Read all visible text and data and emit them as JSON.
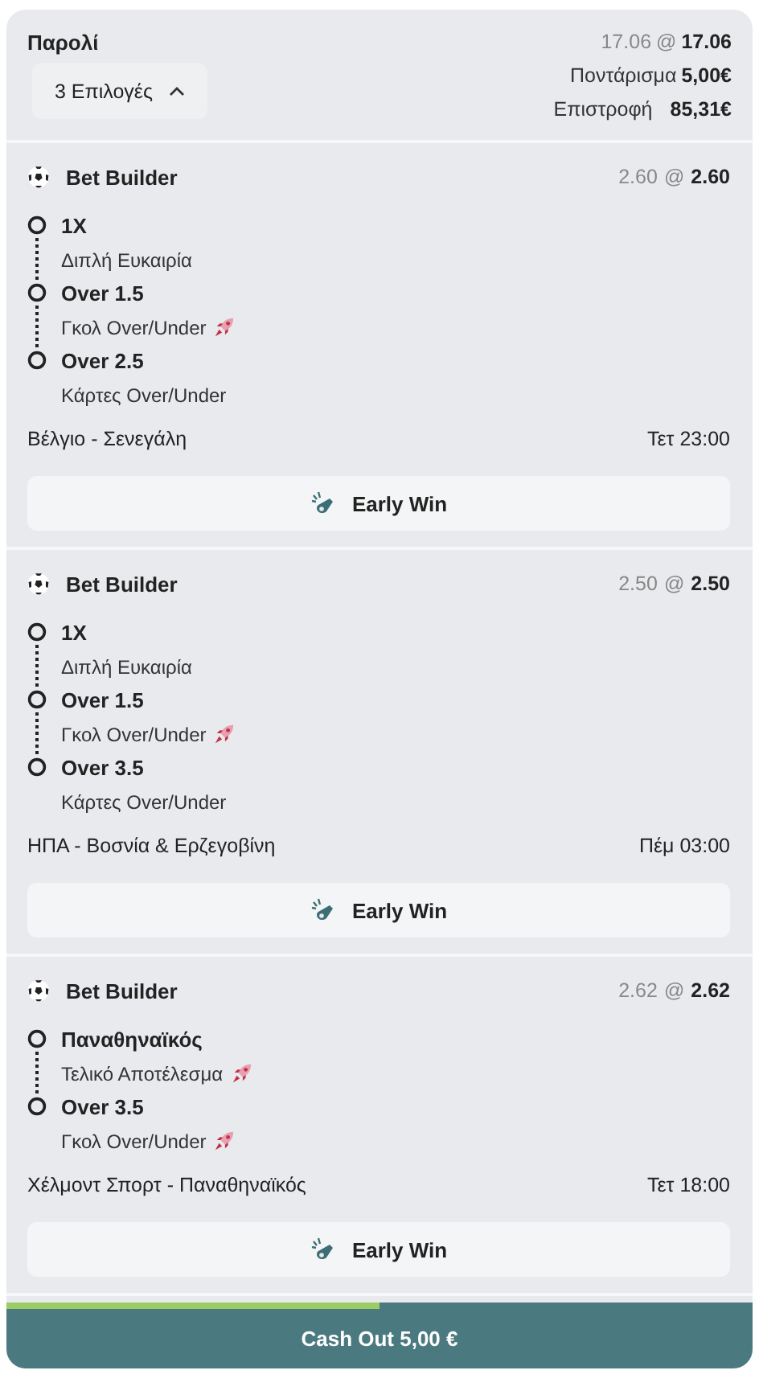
{
  "header": {
    "title": "Παρολί",
    "selections_button": {
      "label": "3 Επιλογές",
      "expanded": true
    },
    "original_odds": "17.06",
    "at": "@",
    "odds": "17.06",
    "stake_label": "Ποντάρισμα",
    "stake": "5,00€",
    "return_label": "Επιστροφή",
    "return": "85,31€"
  },
  "bets": [
    {
      "title": "Bet Builder",
      "original_odds": "2.60",
      "at": "@",
      "odds": "2.60",
      "selections": [
        {
          "pick": "1X",
          "market": "Διπλή Ευκαιρία",
          "boosted": false
        },
        {
          "pick": "Over 1.5",
          "market": "Γκολ Over/Under",
          "boosted": true
        },
        {
          "pick": "Over 2.5",
          "market": "Κάρτες Over/Under",
          "boosted": false
        }
      ],
      "match": "Βέλγιο - Σενεγάλη",
      "time": "Τετ 23:00",
      "button": "Early Win"
    },
    {
      "title": "Bet Builder",
      "original_odds": "2.50",
      "at": "@",
      "odds": "2.50",
      "selections": [
        {
          "pick": "1X",
          "market": "Διπλή Ευκαιρία",
          "boosted": false
        },
        {
          "pick": "Over 1.5",
          "market": "Γκολ Over/Under",
          "boosted": true
        },
        {
          "pick": "Over 3.5",
          "market": "Κάρτες Over/Under",
          "boosted": false
        }
      ],
      "match": "ΗΠΑ - Βοσνία & Ερζεγοβίνη",
      "time": "Πέμ 03:00",
      "button": "Early Win"
    },
    {
      "title": "Bet Builder",
      "original_odds": "2.62",
      "at": "@",
      "odds": "2.62",
      "selections": [
        {
          "pick": "Παναθηναϊκός",
          "market": "Τελικό Αποτέλεσμα",
          "boosted": true
        },
        {
          "pick": "Over 3.5",
          "market": "Γκολ Over/Under",
          "boosted": true
        }
      ],
      "match": "Χέλμοντ Σπορτ - Παναθηναϊκός",
      "time": "Τετ 18:00",
      "button": "Early Win"
    }
  ],
  "cash_out": {
    "level": 0.5,
    "label": "Cash Out 5,00 €"
  }
}
